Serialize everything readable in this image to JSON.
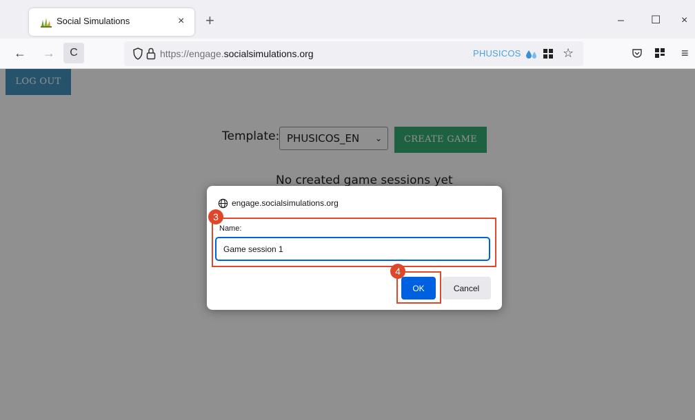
{
  "browser": {
    "tab": {
      "title": "Social Simulations",
      "close_glyph": "×",
      "favicon": "grass-favicon-icon"
    },
    "newtab_glyph": "+",
    "window_controls": {
      "minimize": "–",
      "maximize": "☐",
      "close": "×"
    },
    "nav": {
      "back": "←",
      "forward": "→",
      "reload": "C"
    },
    "url": {
      "prefix": "https://engage.",
      "domain": "socialsimulations.org"
    },
    "extension": {
      "label": "PHUSICOS"
    },
    "star_glyph": "☆",
    "pocket_glyph": "♡",
    "menu_glyph": "≡"
  },
  "page": {
    "logout_label": "LOG OUT",
    "template_label": "Template:",
    "template_selected": "PHUSICOS_EN",
    "create_game_label": "CREATE GAME",
    "no_sessions_text": "No created game sessions yet"
  },
  "dialog": {
    "origin": "engage.socialsimulations.org",
    "field_label": "Name:",
    "field_value": "Game session 1",
    "ok_label": "OK",
    "cancel_label": "Cancel"
  },
  "annotations": {
    "step3": "3",
    "step4": "4",
    "highlight_color": "#e0472a"
  },
  "colors": {
    "logout_button": "#3b8dbd",
    "create_button": "#2ea86e",
    "dialog_accent": "#0061e0"
  }
}
